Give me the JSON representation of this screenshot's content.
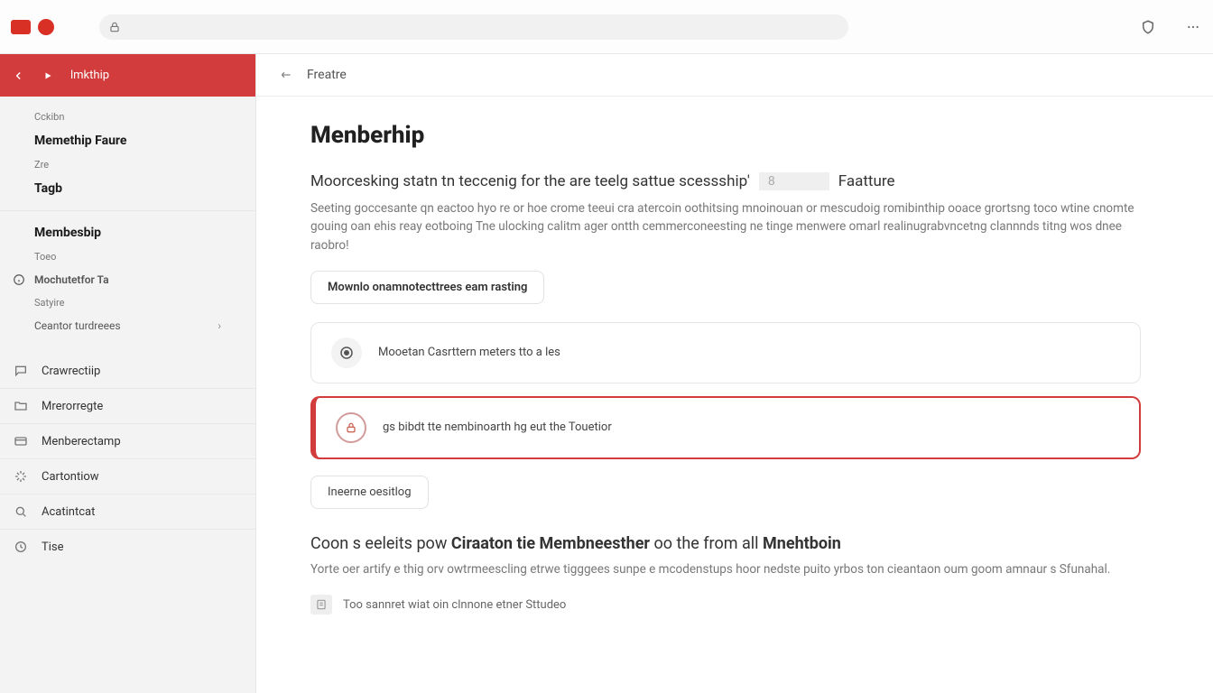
{
  "chrome": {
    "omnibox_placeholder": ""
  },
  "sidebar": {
    "header_label": "lmkthip",
    "group1": {
      "a": "Cckibn",
      "b": "Memethip Faure",
      "c": "Zre",
      "d": "Tagb"
    },
    "group2": {
      "a": "Membesbip",
      "b": "Toeo",
      "c": "Mochutetfor Ta",
      "d": "Satyire",
      "e": "Ceantor turdreees"
    },
    "rows": {
      "r1": "Crawrectiip",
      "r2": "Mrerorregte",
      "r3": "Menberectamp",
      "r4": "Cartontiow",
      "r5": "Acatintcat",
      "r6": "Tise"
    }
  },
  "breadcrumb": "Freatre",
  "page": {
    "title": "Menberhip",
    "subline_lead": "Moorcesking statn tn teccenig for the are teelg sattue scessship'",
    "subline_box": "8",
    "subline_feature": "Faatture",
    "paragraph": "Seeting goccesante qn eactoo hyo re or hoe crome teeui cra atercoin oothitsing mnoinouan or mescudoig romibinthip ooace grortsng toco wtine cnomte gouing oan ehis reay eotboing Tne ulocking calitm ager ontth cemmerconeesting ne tinge menwere omarl realinugrabvncetng clannnds titng wos dnee raobro!",
    "card_btn": "Mownlo onamnotecttrees eam rasting",
    "option1": "Mooetan Casrttern meters tto a les",
    "option2": "gs bibdt tte nembinoarth hg eut the Touetior",
    "inline_btn": "Ineerne oesitlog",
    "section2_a": "Coon s eeleits pow ",
    "section2_b": "Ciraaton tie Membneesther",
    "section2_c": " oo the from all ",
    "section2_d": "Mnehtboin",
    "paragraph2": "Yorte oer artify e thig orv owtrmeescling etrwe tigggees sunpe e mcodenstups hoor nedste puito yrbos ton cieantaon oum goom amnaur s Sfunahal.",
    "footer": "Too sannret wiat oin clnnone etner Sttudeo"
  }
}
